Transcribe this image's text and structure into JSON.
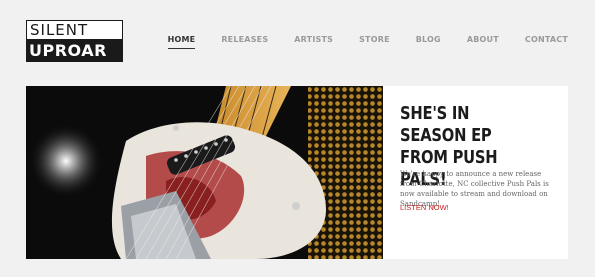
{
  "logo": {
    "line1": "SILENT",
    "line2": "UPROAR"
  },
  "nav": {
    "items": [
      {
        "label": "HOME",
        "active": true
      },
      {
        "label": "RELEASES"
      },
      {
        "label": "ARTISTS"
      },
      {
        "label": "STORE"
      },
      {
        "label": "BLOG"
      },
      {
        "label": "ABOUT"
      },
      {
        "label": "CONTACT"
      }
    ]
  },
  "hero": {
    "title": "SHE'S IN SEASON EP FROM PUSH PALS!",
    "body": "We're happy to announce a new release from Charlotte, NC collective Push Pals is now available to stream and download on Sandcamp!",
    "cta": "LISTEN NOW!"
  },
  "colors": {
    "accent": "#cc1f1f",
    "dark": "#1a1a1a",
    "background": "#f1f1f1"
  }
}
